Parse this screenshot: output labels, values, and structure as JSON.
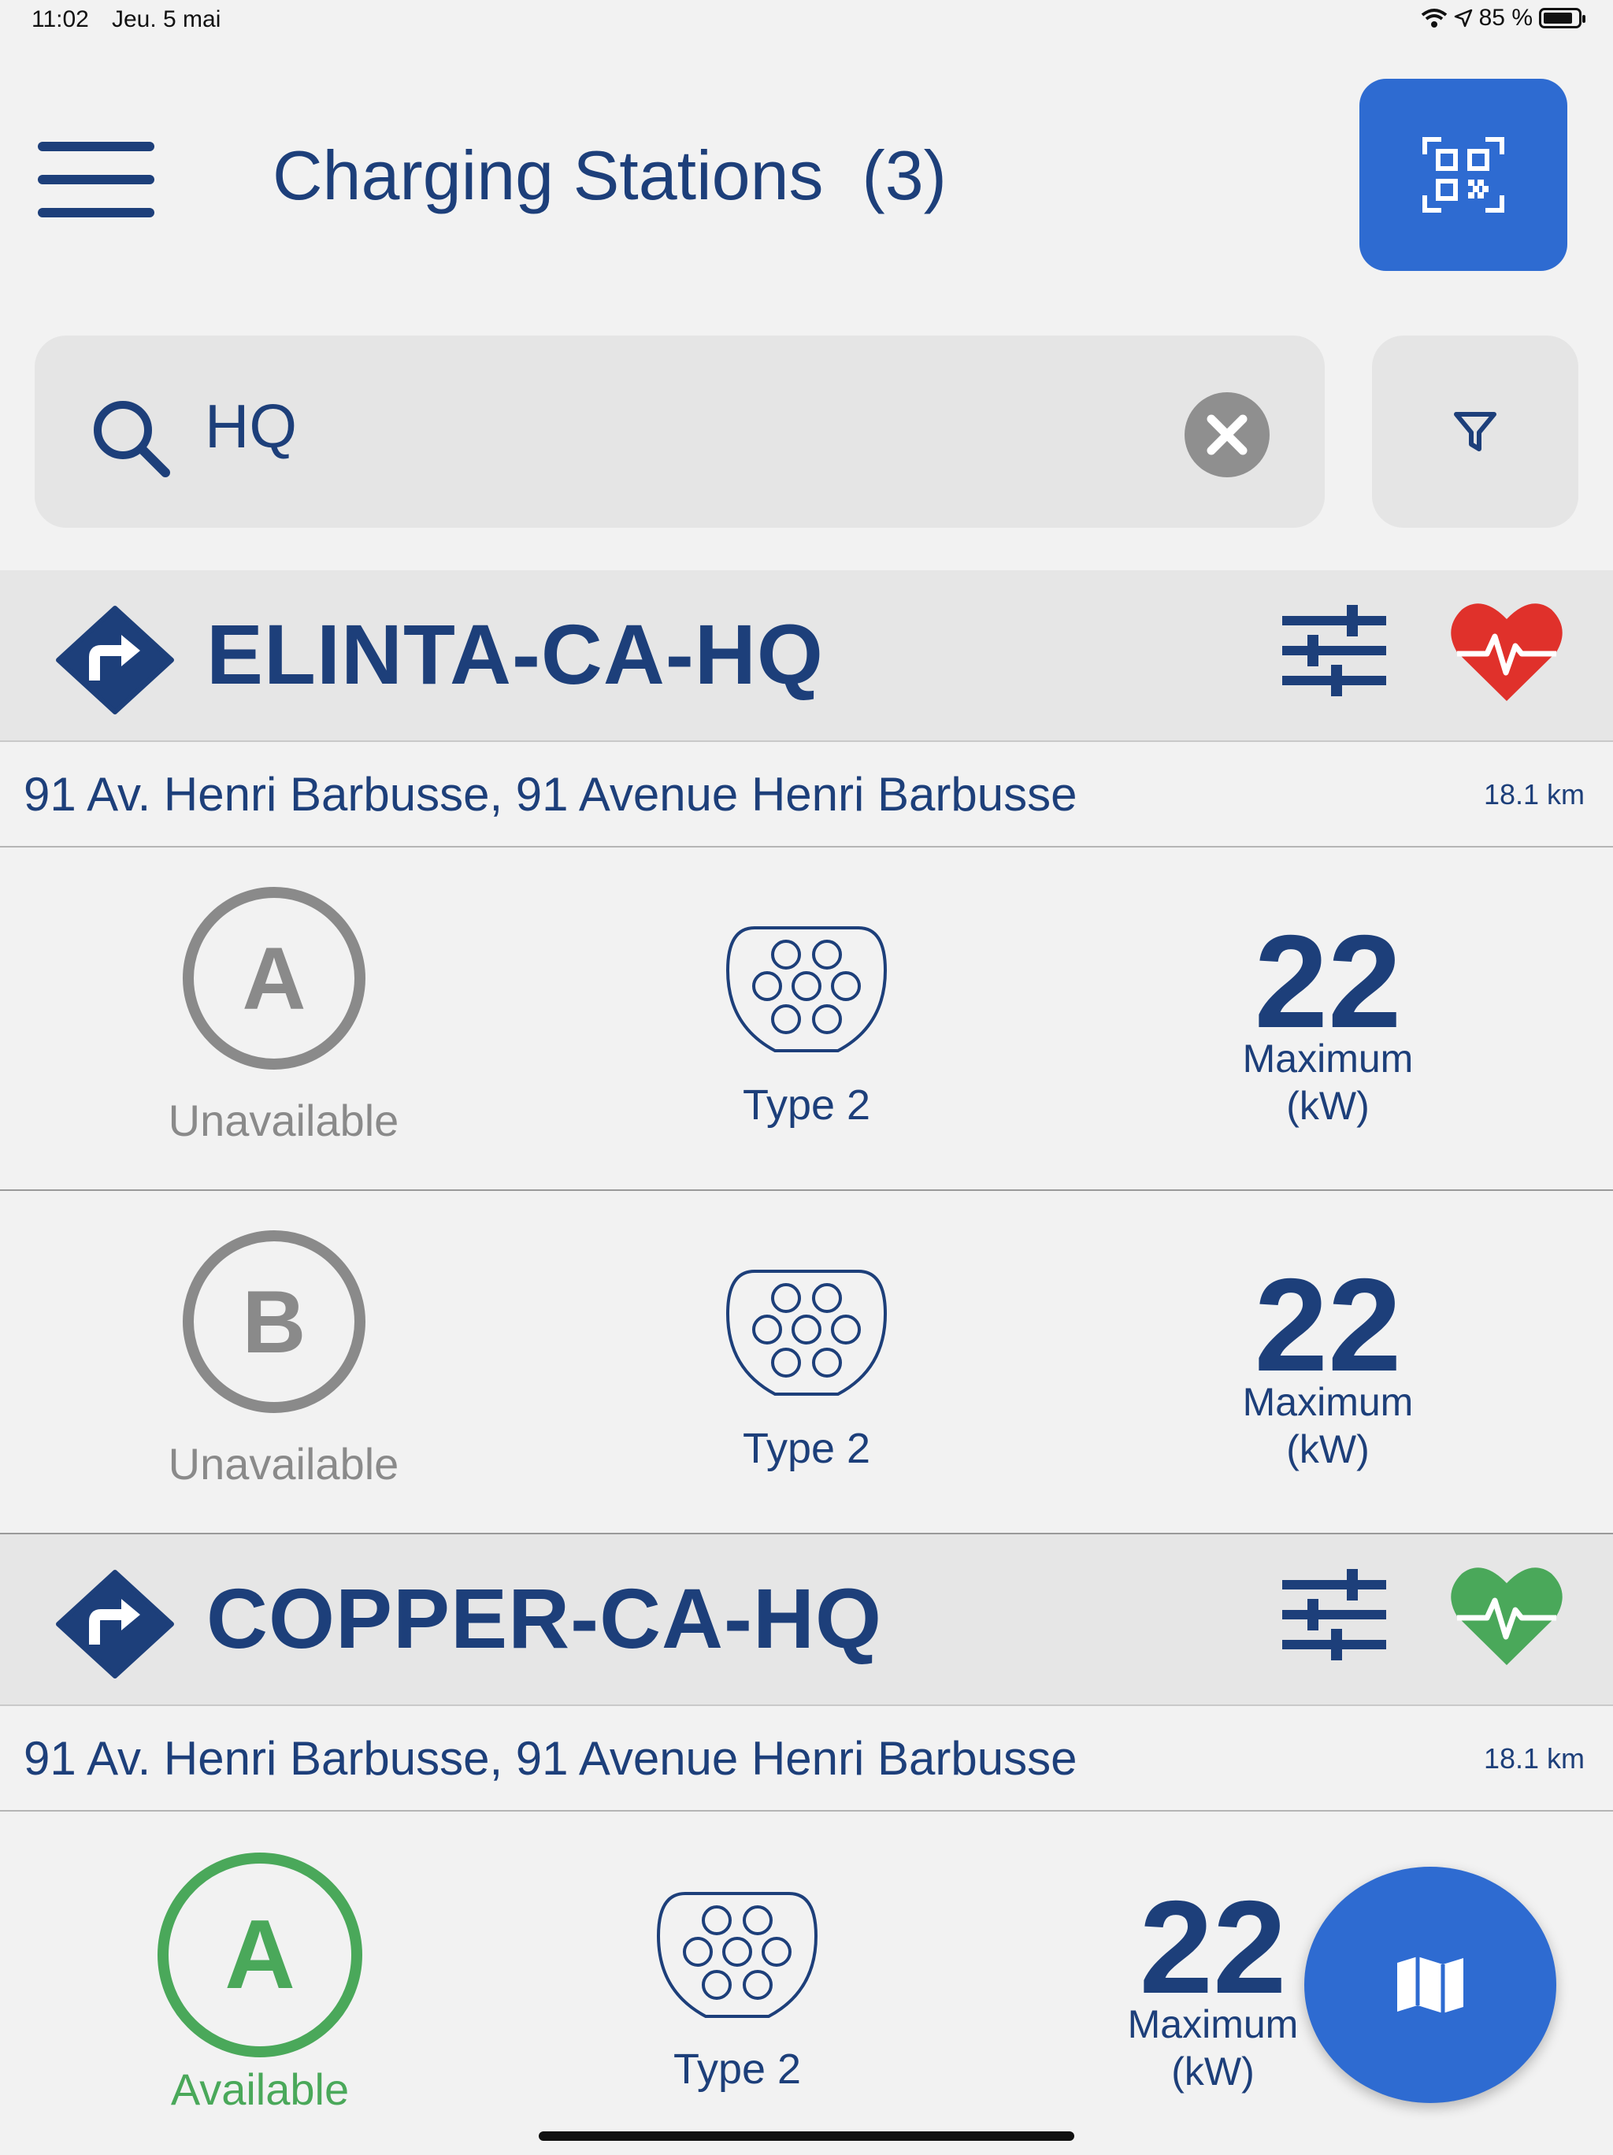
{
  "status_bar": {
    "time": "11:02",
    "date": "Jeu. 5 mai",
    "battery": "85 %"
  },
  "header": {
    "title": "Charging Stations  (3)"
  },
  "search": {
    "value": "HQ"
  },
  "stations": [
    {
      "name": "ELINTA-CA-HQ",
      "health_color": "#e0312b",
      "address": "91 Av. Henri Barbusse, 91 Avenue Henri Barbusse",
      "distance": "18.1 km",
      "connectors": [
        {
          "id": "A",
          "status": "Unavailable",
          "type": "Type 2",
          "power": "22",
          "power_label_1": "Maximum",
          "power_label_2": "(kW)"
        },
        {
          "id": "B",
          "status": "Unavailable",
          "type": "Type 2",
          "power": "22",
          "power_label_1": "Maximum",
          "power_label_2": "(kW)"
        }
      ]
    },
    {
      "name": "COPPER-CA-HQ",
      "health_color": "#4aa85a",
      "address": "91 Av. Henri Barbusse, 91 Avenue Henri Barbusse",
      "distance": "18.1 km",
      "connectors": [
        {
          "id": "A",
          "status": "Available",
          "type": "Type 2",
          "power": "22",
          "power_label_1": "Maximum",
          "power_label_2": "(kW)"
        }
      ]
    }
  ],
  "colors": {
    "primary": "#2e6bd1",
    "text": "#1d3f7a",
    "available": "#4aa85a",
    "unavailable": "#8a8a8a"
  }
}
